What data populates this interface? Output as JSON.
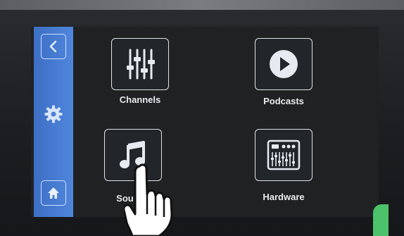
{
  "sidebar": {
    "back_icon": "chevron-left-icon",
    "settings_icon": "gear-icon",
    "home_icon": "home-icon"
  },
  "tiles": [
    {
      "label": "Channels",
      "icon": "sliders-icon"
    },
    {
      "label": "Podcasts",
      "icon": "play-icon"
    },
    {
      "label": "Sounds",
      "icon": "music-note-icon"
    },
    {
      "label": "Hardware",
      "icon": "mixer-icon"
    }
  ],
  "colors": {
    "sidebar": "#4f86dc",
    "screen_bg": "#1f2123",
    "text": "#e9ecef"
  }
}
